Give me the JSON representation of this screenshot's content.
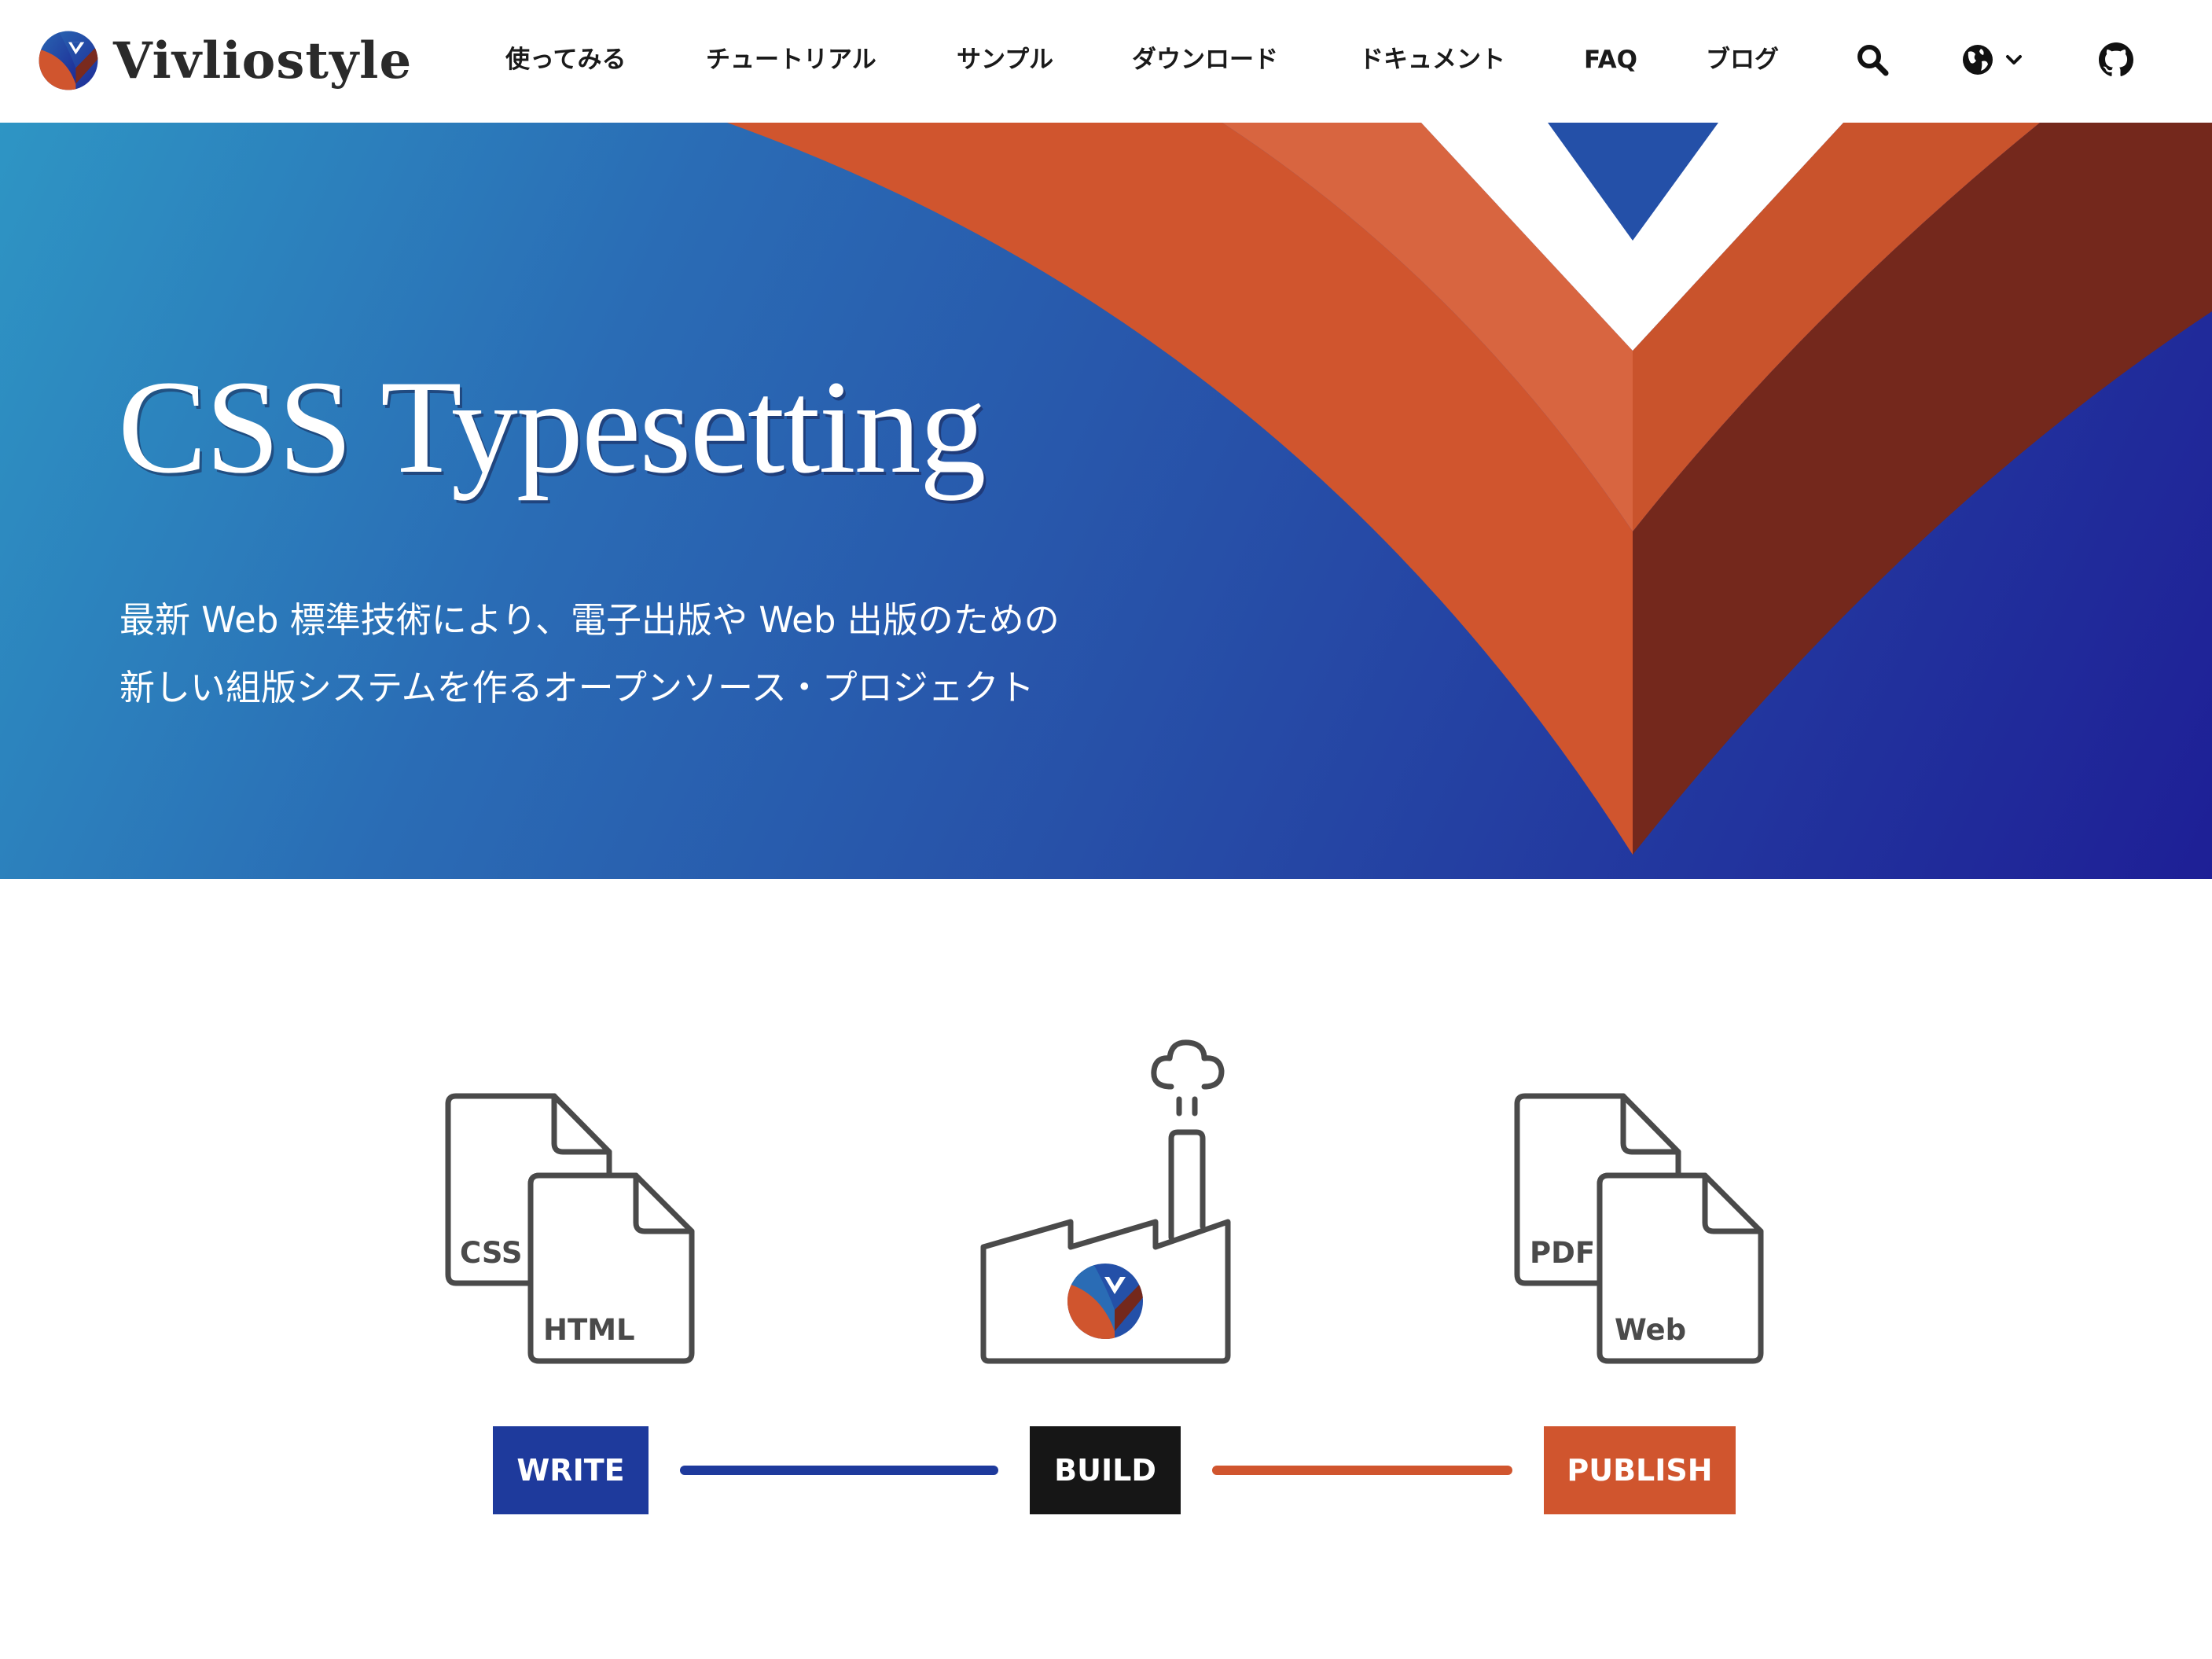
{
  "site": {
    "brand_name": "Vivliostyle",
    "logo_icon": "vivliostyle-v-logo"
  },
  "nav": {
    "items": [
      {
        "label": "使ってみる"
      },
      {
        "label": "チュートリアル"
      },
      {
        "label": "サンプル"
      },
      {
        "label": "ダウンロード"
      },
      {
        "label": "ドキュメント"
      },
      {
        "label": "FAQ"
      },
      {
        "label": "ブログ"
      }
    ],
    "search_icon": "search-icon",
    "language_icon": "globe-icon",
    "language_dropdown_icon": "chevron-down-icon",
    "github_icon": "github-icon"
  },
  "hero": {
    "title": "CSS Typesetting",
    "subtitle_line1": "最新 Web 標準技術により、電子出版や Web 出版のための",
    "subtitle_line2": "新しい組版システムを作るオープンソース・プロジェクト"
  },
  "workflow": {
    "write": {
      "label": "WRITE",
      "doc_back": "CSS",
      "doc_front": "HTML",
      "icon": "documents-icon"
    },
    "build": {
      "label": "BUILD",
      "icon": "factory-icon"
    },
    "publish": {
      "label": "PUBLISH",
      "doc_back": "PDF",
      "doc_front": "Web",
      "icon": "documents-icon"
    }
  },
  "colors": {
    "blue": "#1e3a9c",
    "black": "#161616",
    "orange": "#d0552e",
    "hero_gradient_start": "#2e95c4",
    "hero_gradient_end": "#1e1f96"
  }
}
